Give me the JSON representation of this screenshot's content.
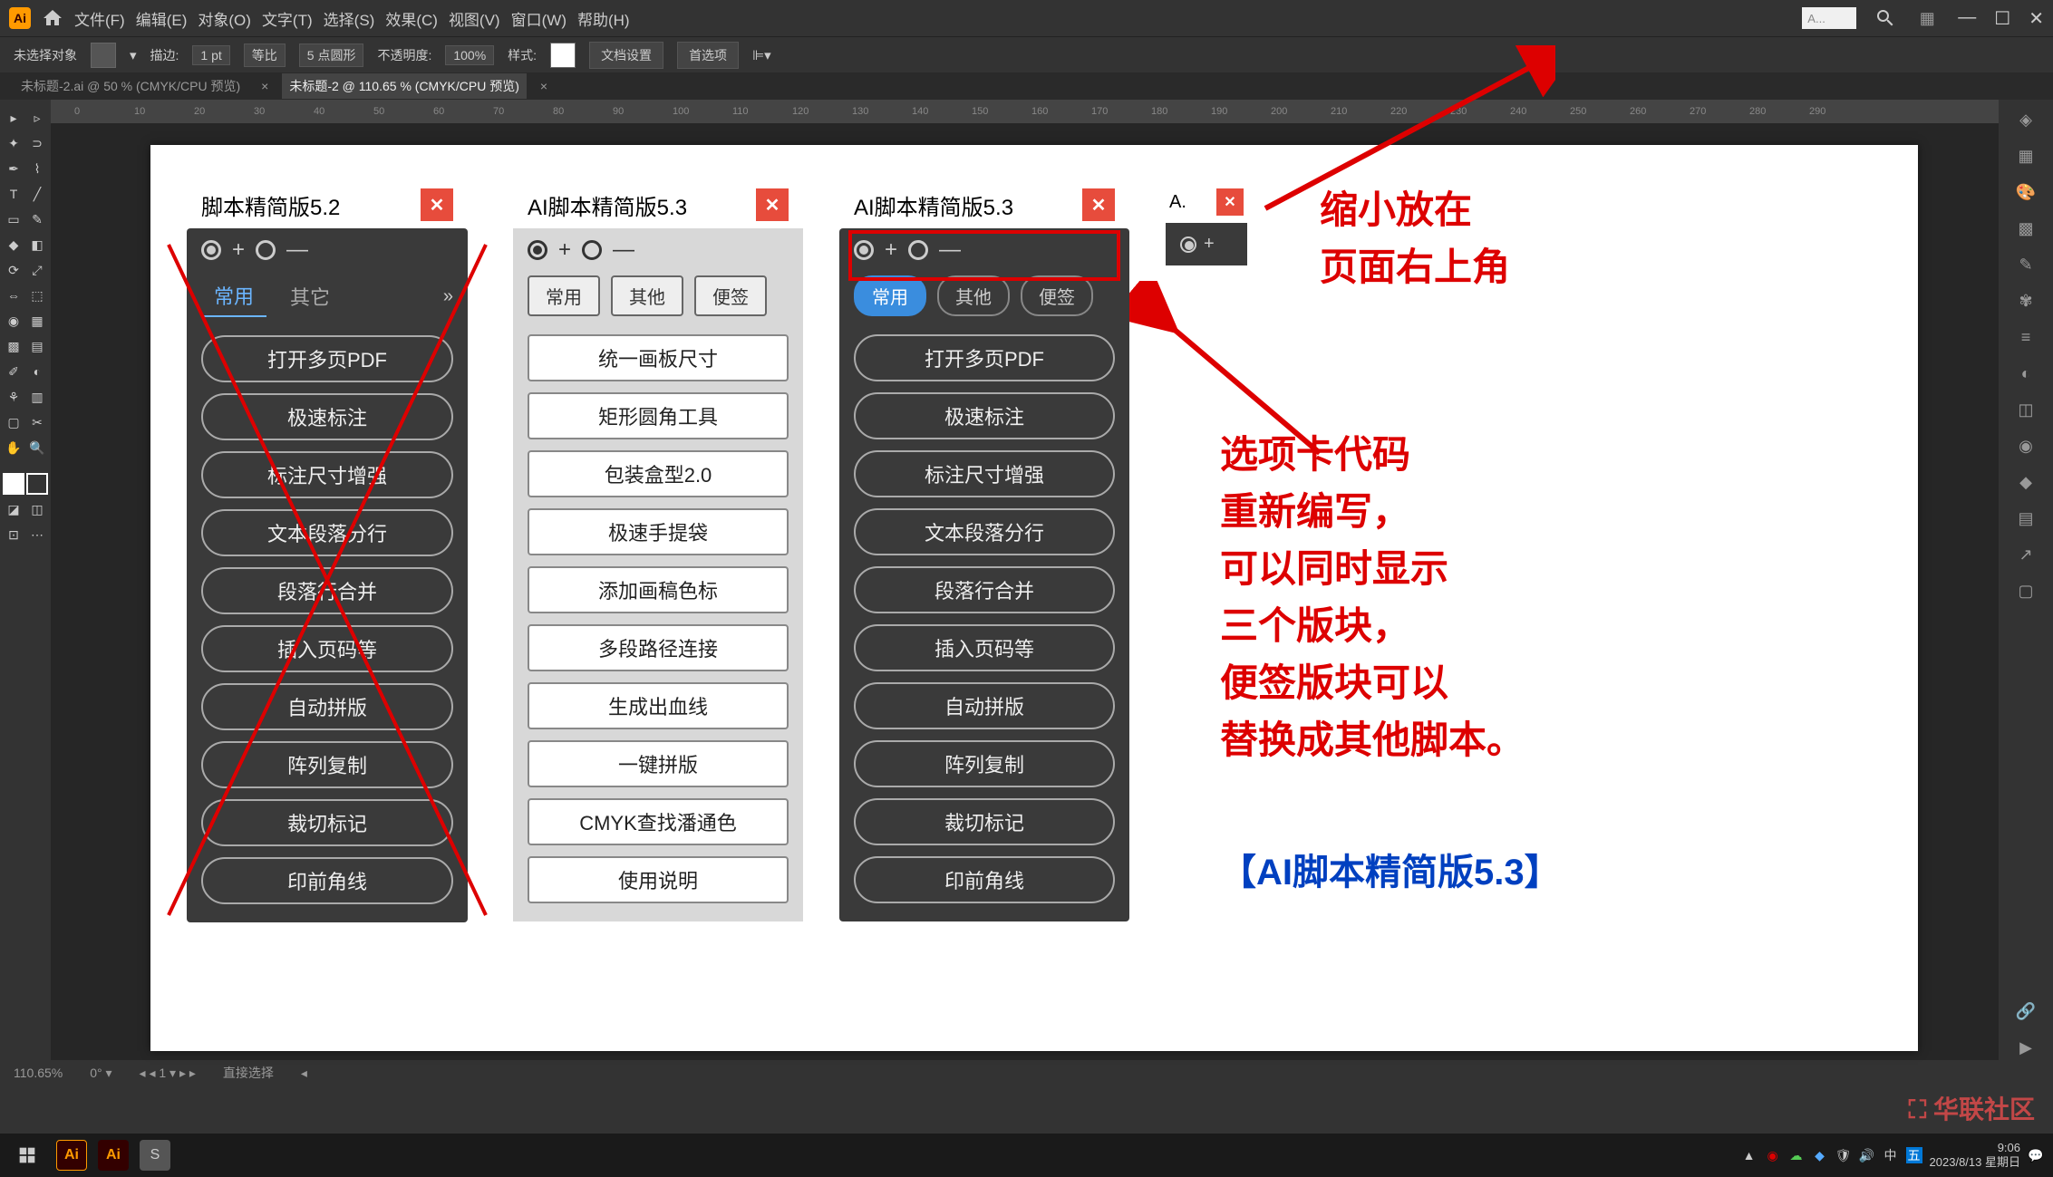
{
  "menubar": {
    "items": [
      "文件(F)",
      "编辑(E)",
      "对象(O)",
      "文字(T)",
      "选择(S)",
      "效果(C)",
      "视图(V)",
      "窗口(W)",
      "帮助(H)"
    ],
    "search_placeholder": "A..."
  },
  "optionsbar": {
    "no_selection": "未选择对象",
    "stroke_label": "描边:",
    "stroke_value": "1 pt",
    "uniform": "等比",
    "points": "5 点圆形",
    "opacity_label": "不透明度:",
    "opacity_value": "100%",
    "style_label": "样式:",
    "doc_setup": "文档设置",
    "preferences": "首选项"
  },
  "doctabs": {
    "tab1": "未标题-2.ai @ 50 % (CMYK/CPU 预览)",
    "tab2": "未标题-2 @ 110.65 % (CMYK/CPU 预览)"
  },
  "ruler_values": [
    "0",
    "10",
    "20",
    "30",
    "40",
    "50",
    "60",
    "70",
    "80",
    "90",
    "100",
    "110",
    "120",
    "130",
    "140",
    "150",
    "160",
    "170",
    "180",
    "190",
    "200",
    "210",
    "220",
    "230",
    "240",
    "250",
    "260",
    "270",
    "280",
    "290"
  ],
  "panel52": {
    "title": "脚本精简版5.2",
    "tabs": {
      "common": "常用",
      "other": "其它"
    },
    "buttons": [
      "打开多页PDF",
      "极速标注",
      "标注尺寸增强",
      "文本段落分行",
      "段落行合并",
      "插入页码等",
      "自动拼版",
      "阵列复制",
      "裁切标记",
      "印前角线"
    ]
  },
  "panel53_light": {
    "title": "AI脚本精简版5.3",
    "tabs": {
      "common": "常用",
      "other": "其他",
      "notes": "便签"
    },
    "buttons": [
      "统一画板尺寸",
      "矩形圆角工具",
      "包装盒型2.0",
      "极速手提袋",
      "添加画稿色标",
      "多段路径连接",
      "生成出血线",
      "一键拼版",
      "CMYK查找潘通色",
      "使用说明"
    ]
  },
  "panel53_dark": {
    "title": "AI脚本精简版5.3",
    "tabs": {
      "common": "常用",
      "other": "其他",
      "notes": "便签"
    },
    "buttons": [
      "打开多页PDF",
      "极速标注",
      "标注尺寸增强",
      "文本段落分行",
      "段落行合并",
      "插入页码等",
      "自动拼版",
      "阵列复制",
      "裁切标记",
      "印前角线"
    ]
  },
  "panel_mini": {
    "title": "A."
  },
  "annotations": {
    "top_right": "缩小放在\n页面右上角",
    "middle": "选项卡代码\n重新编写，\n可以同时显示\n三个版块，\n便签版块可以\n替换成其他脚本。",
    "bottom_blue": "【AI脚本精简版5.3】"
  },
  "statusbar": {
    "zoom": "110.65%",
    "tool": "直接选择"
  },
  "taskbar": {
    "time": "9:06",
    "date": "2023/8/13 星期日"
  },
  "watermark": "华联社区"
}
